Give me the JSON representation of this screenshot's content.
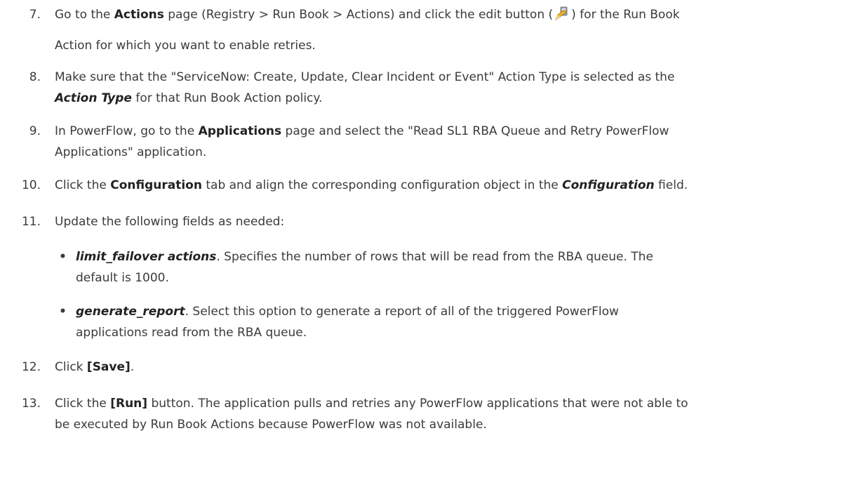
{
  "steps": [
    {
      "num": "7.",
      "l1_pre": "Go to the ",
      "l1_bold": "Actions",
      "l1_mid": " page (Registry > Run Book > Actions) and click the edit button (",
      "l1_icon": "pencil-icon",
      "l1_post": ") for the Run Book",
      "l2": "Action for which you want to enable retries."
    },
    {
      "num": "8.",
      "l1": "Make sure that the \"ServiceNow: Create, Update, Clear Incident or Event\" Action Type is selected as the",
      "l2_field": "Action Type",
      "l2_post": " for that Run Book Action policy."
    },
    {
      "num": "9.",
      "l1_pre": "In PowerFlow, go to the ",
      "l1_bold": "Applications",
      "l1_post": " page and select the \"Read SL1 RBA Queue and Retry PowerFlow",
      "l2": "Applications\" application."
    },
    {
      "num": "10.",
      "pre": "Click the ",
      "bold": "Configuration",
      "mid": " tab and align the corresponding configuration object in the ",
      "field": "Configuration",
      "post": " field."
    },
    {
      "num": "11.",
      "text": "Update the following fields as needed:"
    },
    {
      "num": "12.",
      "pre": "Click ",
      "bold": "[Save]",
      "post": "."
    },
    {
      "num": "13.",
      "l1_pre": "Click the ",
      "l1_bold": "[Run]",
      "l1_post": " button. The application pulls and retries any PowerFlow applications that were not able to",
      "l2": "be executed by Run Book Actions because PowerFlow was not available."
    }
  ],
  "bullets": [
    {
      "field": "limit_failover actions",
      "l1_post": ". Specifies the number of rows that will be read from the RBA queue. The",
      "l2": "default is 1000."
    },
    {
      "field": "generate_report",
      "l1_post": ". Select this option to generate a report of all of the triggered PowerFlow",
      "l2": "applications read from the RBA queue."
    }
  ],
  "colors": {
    "text": "#3b3b3b",
    "icon_pencil": "#f0b020"
  }
}
